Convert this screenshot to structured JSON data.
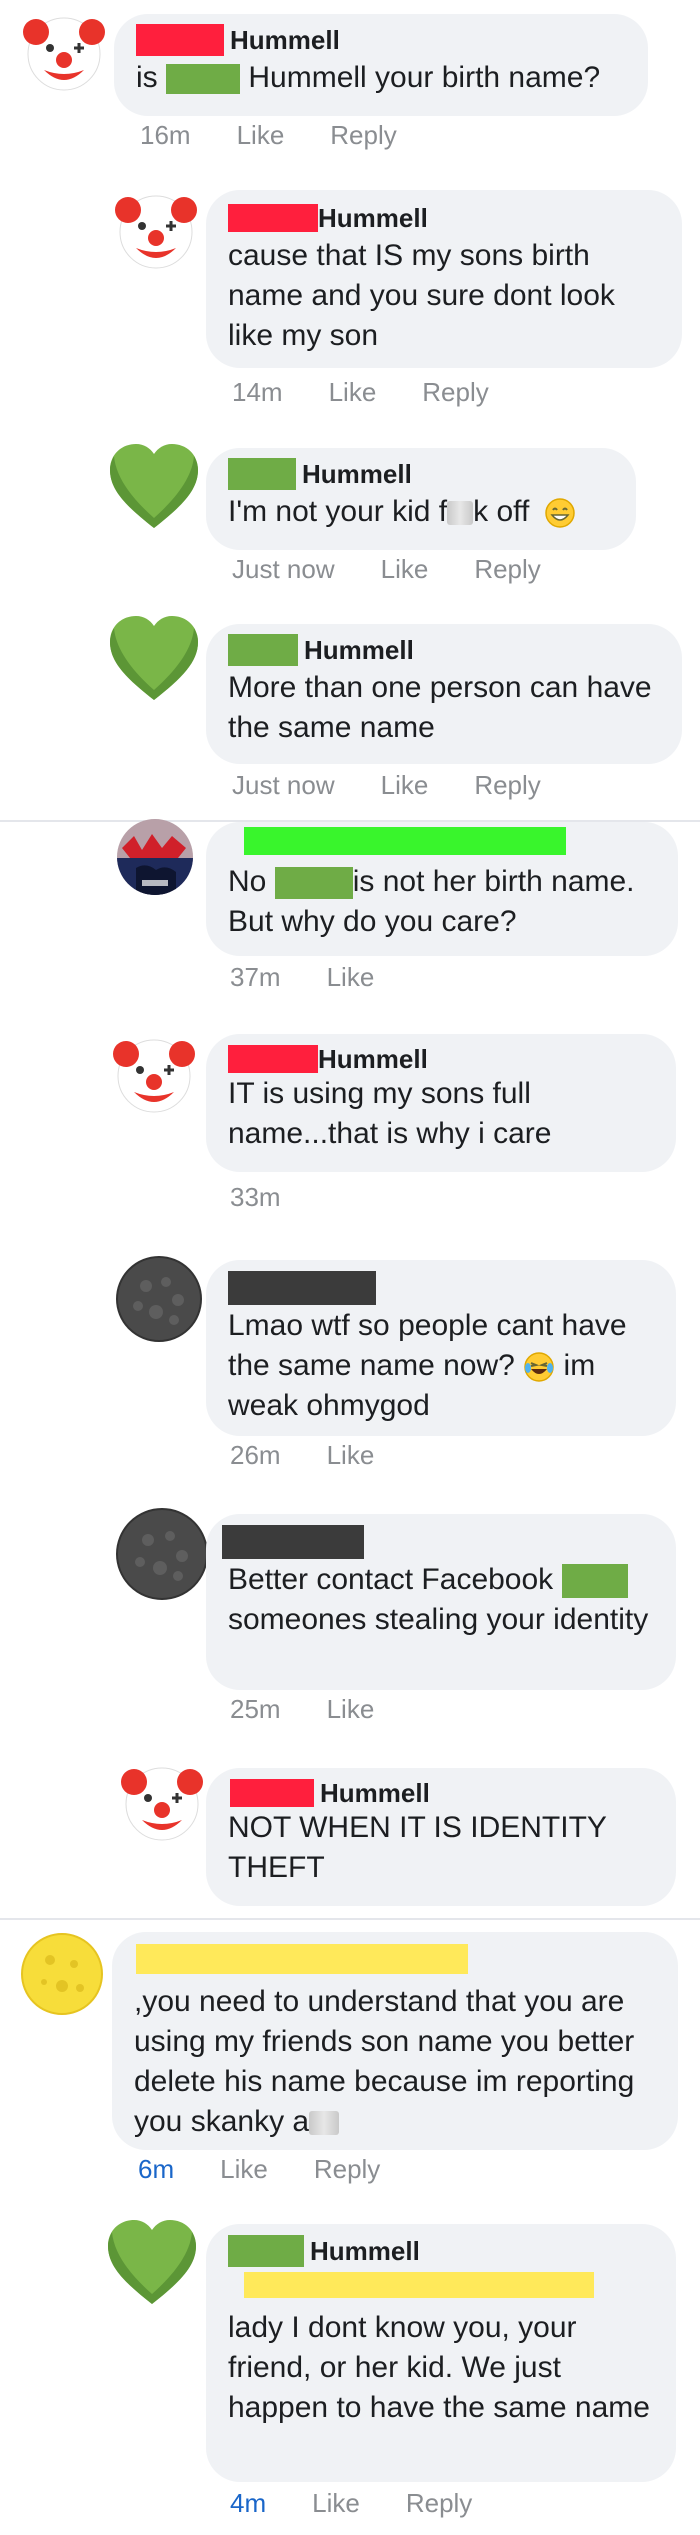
{
  "comments": [
    {
      "id": "c1",
      "name": "Hummell",
      "text_prefix": "is",
      "text": "Hummell your birth name?",
      "time": "16m",
      "like": "Like",
      "reply": "Reply"
    },
    {
      "id": "c2",
      "name": "Hummell",
      "text": "cause that IS my sons birth name and you sure dont look like my son",
      "time": "14m",
      "like": "Like",
      "reply": "Reply"
    },
    {
      "id": "c3",
      "name": "Hummell",
      "text_a": "I'm not your kid f",
      "text_b": "k off",
      "time": "Just now",
      "like": "Like",
      "reply": "Reply"
    },
    {
      "id": "c4",
      "name": "Hummell",
      "text": "More than one person can have the same name",
      "time": "Just now",
      "like": "Like",
      "reply": "Reply"
    },
    {
      "id": "c5",
      "text_a": "No",
      "text_b": "is not her birth name.",
      "text_c": "But why do you care?",
      "time": "37m",
      "like": "Like"
    },
    {
      "id": "c6",
      "name": "Hummell",
      "text": "IT is using my sons full name...that is why i care",
      "time": "33m"
    },
    {
      "id": "c7",
      "text": "Lmao wtf so people cant have the same name now?",
      "text_after": "im weak ohmygod",
      "time": "26m",
      "like": "Like"
    },
    {
      "id": "c8",
      "text_a": "Better contact Facebook",
      "text_b": "someones stealing your identity",
      "time": "25m",
      "like": "Like"
    },
    {
      "id": "c9",
      "name": "Hummell",
      "text": "NOT WHEN IT IS IDENTITY THEFT"
    },
    {
      "id": "c10",
      "text": ",you need to understand that you are using my friends son name you better delete his name because im reporting you skanky a",
      "time": "6m",
      "like": "Like",
      "reply": "Reply"
    },
    {
      "id": "c11",
      "name": "Hummell",
      "text": "lady I dont know you, your friend, or her kid. We just happen to have the same name",
      "time": "4m",
      "like": "Like",
      "reply": "Reply"
    }
  ],
  "colors": {
    "redact_red": "#ff1f3d",
    "redact_green": "#6fac46",
    "redact_dark": "#3b3b3b",
    "redact_lime": "#39f52c",
    "redact_yellow": "#ffe95a",
    "bubble": "#f0f2f5",
    "meta": "#8a8d91",
    "link_blue": "#1a66c9"
  },
  "icons": [
    "clown-face-icon",
    "green-heart-icon",
    "grinning-emoji-icon",
    "laughing-crying-emoji-icon",
    "dark-gray-avatar",
    "yellow-moon-avatar",
    "profile-photo-avatar"
  ]
}
